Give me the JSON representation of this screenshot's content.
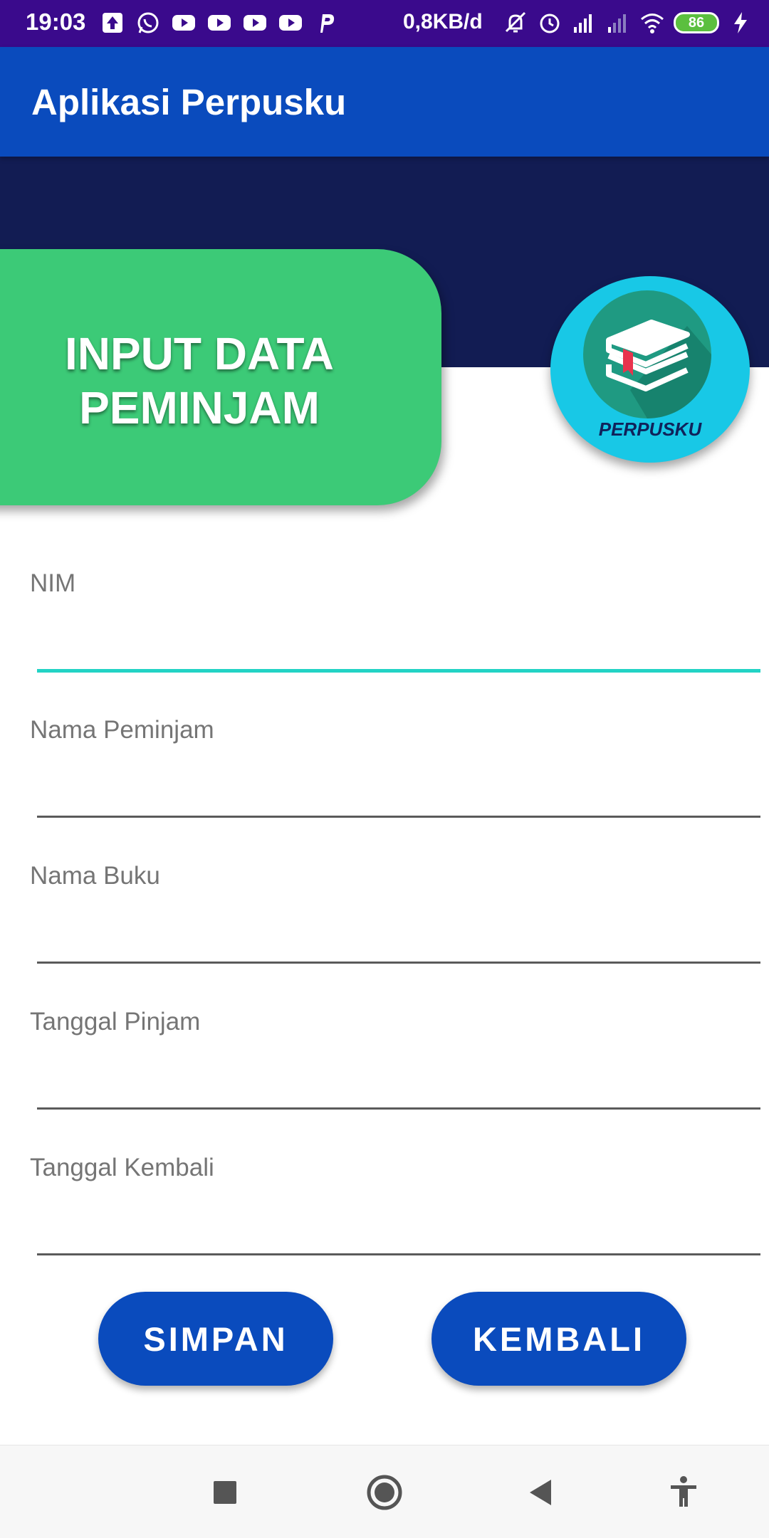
{
  "status_bar": {
    "time": "19:03",
    "net_speed": "0,8KB/d",
    "battery": "86",
    "icons": [
      "upload-icon",
      "whatsapp-icon",
      "youtube-icon",
      "youtube-icon",
      "youtube-icon",
      "youtube-icon",
      "p-app-icon",
      "mute-icon",
      "alarm-icon",
      "signal-icon",
      "signal-icon",
      "wifi-icon",
      "battery-icon",
      "charging-icon"
    ],
    "colors": {
      "background": "#3a0a8c",
      "battery": "#5bbf3f"
    }
  },
  "app_bar": {
    "title": "Aplikasi Perpusku",
    "color": "#0a4bbd"
  },
  "header": {
    "banner_line1": "INPUT DATA",
    "banner_line2": "PEMINJAM",
    "banner_color": "#3cca77",
    "band_color": "#121c53",
    "logo_text": "PERPUSKU",
    "logo_color": "#18c8e6"
  },
  "form": {
    "fields": [
      {
        "label": "NIM",
        "value": "",
        "focused": true
      },
      {
        "label": "Nama Peminjam",
        "value": "",
        "focused": false
      },
      {
        "label": "Nama Buku",
        "value": "",
        "focused": false
      },
      {
        "label": "Tanggal Pinjam",
        "value": "",
        "focused": false
      },
      {
        "label": "Tanggal Kembali",
        "value": "",
        "focused": false
      }
    ],
    "focus_color": "#22d3c5"
  },
  "buttons": {
    "save_label": "SIMPAN",
    "back_label": "KEMBALI",
    "color": "#0a4bbd"
  },
  "nav_bar": {
    "icons": [
      "recents-square-icon",
      "home-circle-icon",
      "back-triangle-icon",
      "accessibility-icon"
    ]
  }
}
